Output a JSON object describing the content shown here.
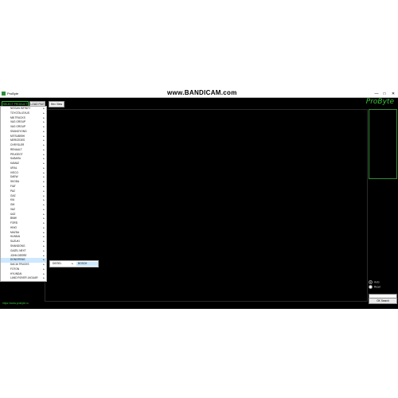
{
  "window": {
    "title": "ProByte",
    "watermark": "www.BANDICAM.com",
    "minimize": "—",
    "maximize": "□",
    "close": "✕"
  },
  "toolbar": {
    "select_label": "SELECT PRODUCT",
    "load_file_label": "LOAD FILE",
    "hex_view_label": "Hex View"
  },
  "brand": "ProByte",
  "menu": {
    "items": [
      "NISSAN INFINITI",
      "TOYOTA LEXUS",
      "MB TRUCKS",
      "VAG GROUP",
      "VAG GROUP",
      "SSANGYONG",
      "MITSUBISHI",
      "MERCEDES",
      "CHRYSLER",
      "RENAULT",
      "PEUGEOT",
      "SUBARU",
      "KAMAZ",
      "URAL",
      "IVECO",
      "DAEW",
      "SKODA",
      "FIAT",
      "PAZ",
      "GAZ",
      "KIA",
      "GM",
      "VAZ",
      "UAZ",
      "BMW",
      "FORD",
      "HINO",
      "MAZDA",
      "HUNDAI",
      "SUZUKI",
      "SHANDONG",
      "GAZEL NEXT",
      "JOHN DEERE",
      "DONGFENG",
      "DACIA TRUCKS",
      "FOTON",
      "HYUNDAI",
      "LAND ROVER JAGUAR"
    ],
    "active_index": 33
  },
  "submenu": {
    "items": [
      "DIESEL",
      "BOSCH"
    ]
  },
  "side_panel": {
    "radio_1": "Auto",
    "radio_2": "Read",
    "button_label": "OK Search"
  },
  "footer_url": "https://www.probyte.ru"
}
